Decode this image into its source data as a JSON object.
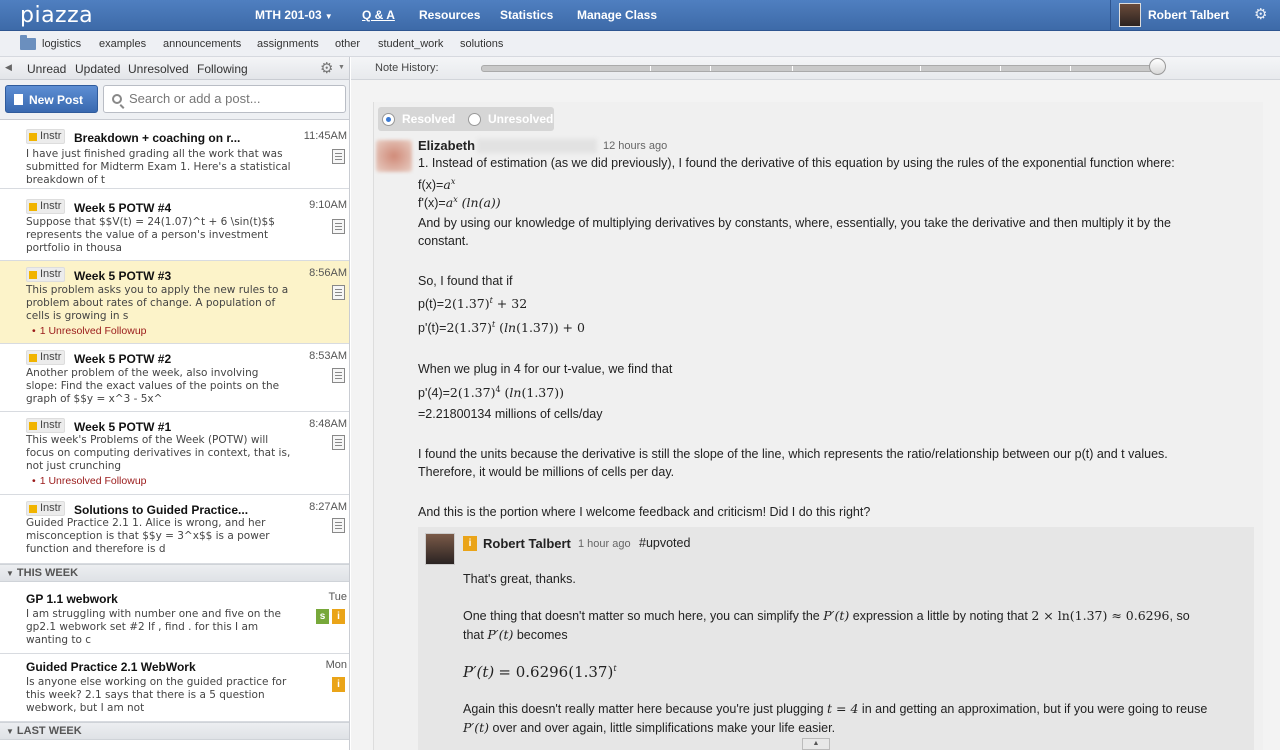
{
  "app": {
    "logo": "piazza"
  },
  "topnav": {
    "course": "MTH 201-03",
    "qa": "Q & A",
    "resources": "Resources",
    "statistics": "Statistics",
    "manage": "Manage Class",
    "user_name": "Robert Talbert"
  },
  "folders": [
    "logistics",
    "examples",
    "announcements",
    "assignments",
    "other",
    "student_work",
    "solutions"
  ],
  "feed_filters": {
    "unread": "Unread",
    "updated": "Updated",
    "unresolved": "Unresolved",
    "following": "Following"
  },
  "feed_tools": {
    "new_post": "New Post",
    "search_placeholder": "Search or add a post..."
  },
  "posts": [
    {
      "tag": "Instr",
      "title": "Breakdown + coaching on r...",
      "time": "11:45AM",
      "body": "I have just finished grading all the work that was submitted for Midterm Exam 1. Here's a statistical breakdown of t"
    },
    {
      "tag": "Instr",
      "title": "Week 5 POTW #4",
      "time": "9:10AM",
      "body": "Suppose that $$V(t) = 24(1.07)^t + 6 \\sin(t)$$ represents the value of a person's investment portfolio in thousa"
    },
    {
      "tag": "Instr",
      "title": "Week 5 POTW #3",
      "time": "8:56AM",
      "body": "This problem asks you to apply the new rules to a problem about rates of change.  A population of cells is growing in s",
      "followup": "1 Unresolved Followup"
    },
    {
      "tag": "Instr",
      "title": "Week 5 POTW #2",
      "time": "8:53AM",
      "body": "Another problem of the week, also involving slope:  Find the exact values of the points on the graph of $$y = x^3 - 5x^"
    },
    {
      "tag": "Instr",
      "title": "Week 5 POTW #1",
      "time": "8:48AM",
      "body": "This week's Problems of the Week (POTW) will focus on computing derivatives in context, that is, not just crunching",
      "followup": "1 Unresolved Followup"
    },
    {
      "tag": "Instr",
      "title": "Solutions to Guided Practice...",
      "time": "8:27AM",
      "body": "Guided Practice 2.1 1. Alice is wrong, and her misconception is that $$y = 3^x$$ is a power function and therefore is d"
    }
  ],
  "groups": {
    "this_week": "THIS WEEK",
    "last_week": "LAST WEEK"
  },
  "week_posts": [
    {
      "title": "GP 1.1 webwork",
      "time": "Tue",
      "body": "I am struggling with number one and five on the gp2.1 webwork set #2     If , find .          for this I am wanting to c",
      "badges": [
        "s",
        "i"
      ]
    },
    {
      "title": "Guided Practice 2.1 WebWork",
      "time": "Mon",
      "body": "Is anyone else working on the guided practice for this week?  2.1 says that there is a 5 question webwork, but I am not",
      "badges": [
        "i"
      ]
    }
  ],
  "history": {
    "label": "Note History:"
  },
  "followup": {
    "resolved": "Resolved",
    "unresolved": "Unresolved",
    "author": "Elizabeth",
    "ago": "12 hours ago",
    "line1": "1. Instead of estimation (as we did previously), I found the derivative of this equation by using the rules of the exponential function where:",
    "f_prefix": "f(x)=",
    "fp_prefix": "f'(x)=",
    "line2": "And by using our knowledge of multiplying derivatives by constants, where, essentially, you take the derivative and then multiply it by the",
    "line2b": "constant.",
    "line3": "So, I found that if",
    "p_prefix": "p(t)=",
    "pp_prefix": "p'(t)=",
    "line4": "When we plug in 4 for our t-value, we find that",
    "pp4_prefix": "p'(4)=",
    "line5": "=2.21800134 millions of cells/day",
    "line6": "I found the units because the derivative is still the slope of the line, which represents the ratio/relationship between our p(t) and t values.",
    "line6b": "Therefore, it would be millions of cells per day.",
    "line7": "And this is the portion where I welcome feedback and criticism! Did I do this right?"
  },
  "reply": {
    "badge": "i",
    "author": "Robert Talbert",
    "ago": "1 hour ago",
    "tag": "#upvoted",
    "line1": "That's great, thanks.",
    "line2a": "One thing that doesn't matter so much here, you can simplify the",
    "line2b": "expression a little by noting that",
    "line2c": ", so",
    "line3a": "that",
    "line3b": "becomes",
    "line4a": "Again this doesn't really matter here because you're just plugging",
    "line4b": "in and getting an approximation, but if you were going to reuse",
    "line5b": "over and over again, little simplifications make your life easier."
  }
}
